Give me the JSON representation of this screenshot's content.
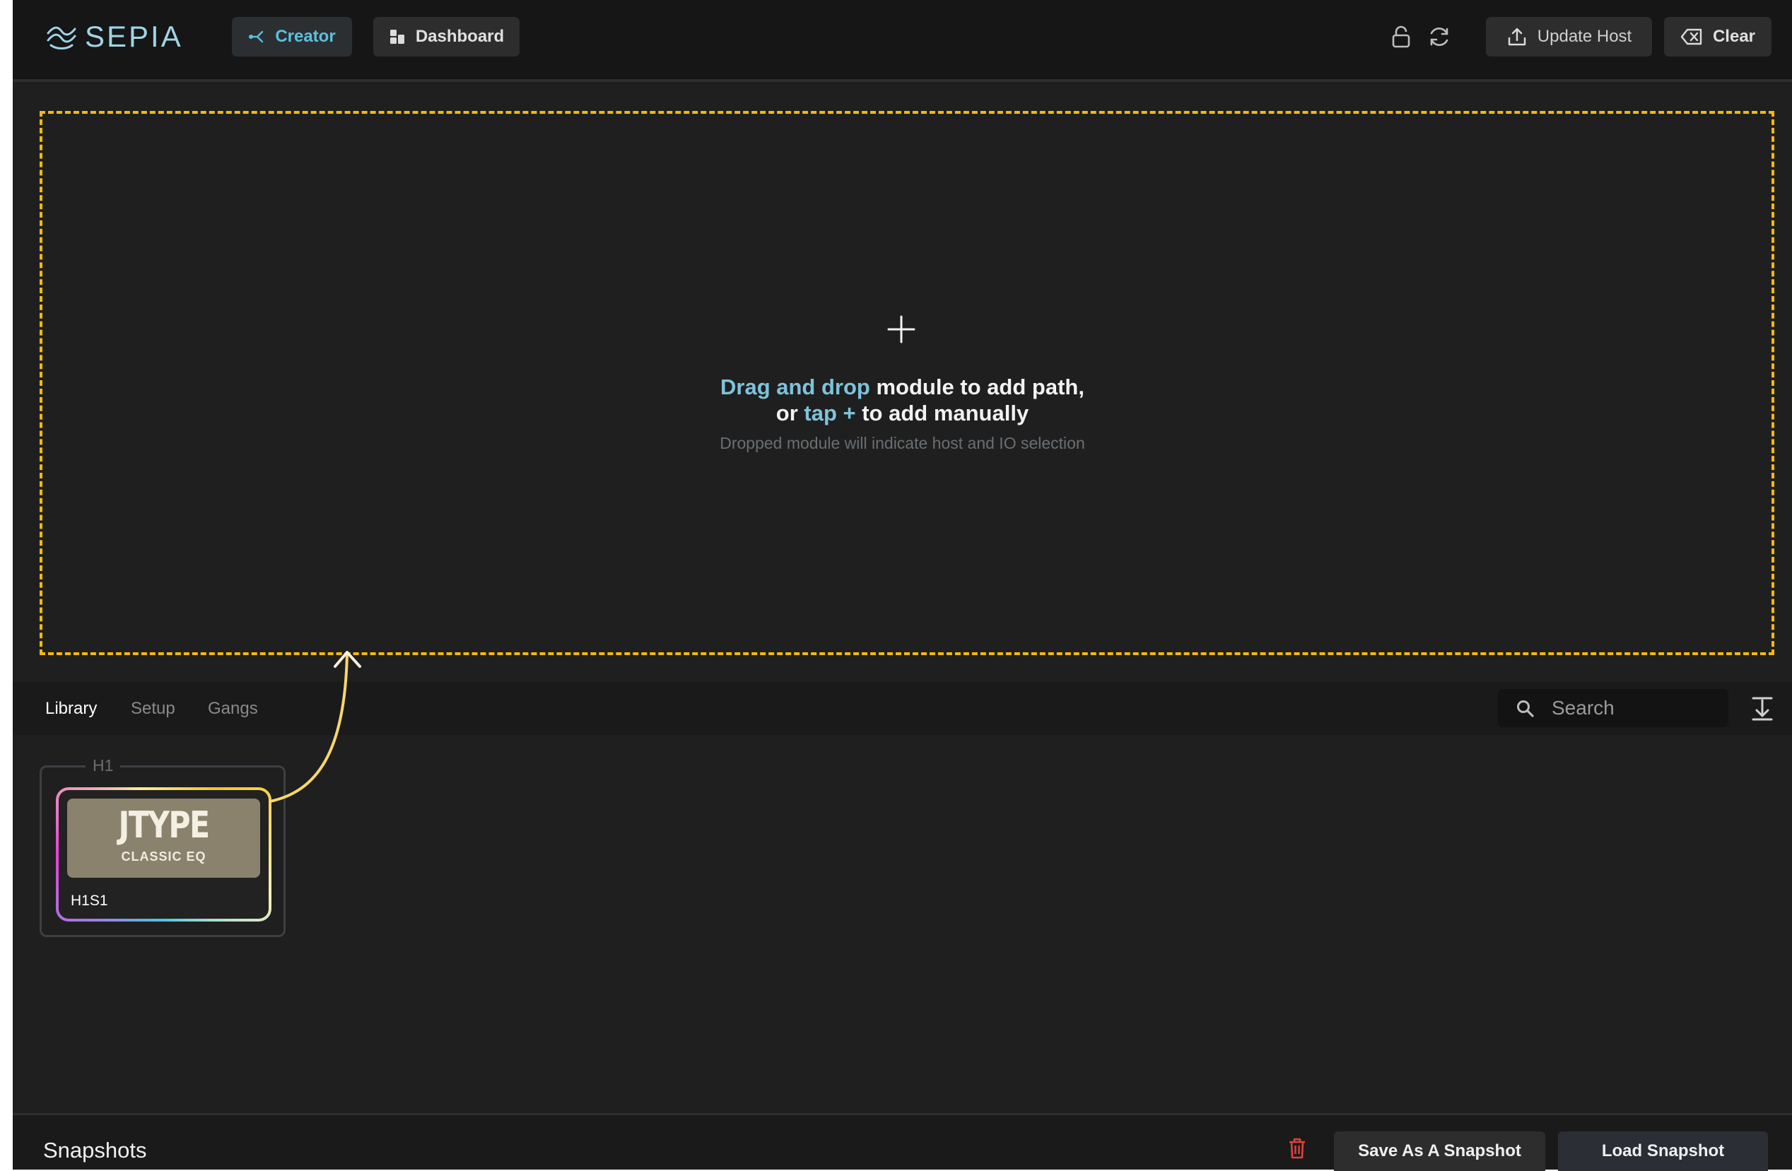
{
  "app": {
    "name": "SEPIA"
  },
  "header": {
    "tabs": [
      {
        "label": "Creator",
        "icon": "route-icon",
        "active": true
      },
      {
        "label": "Dashboard",
        "icon": "dashboard-icon",
        "active": false
      }
    ],
    "update_host_label": "Update Host",
    "clear_label": "Clear"
  },
  "dropzone": {
    "line1_highlight": "Drag and drop",
    "line1_rest": " module to add path,",
    "line2_prefix": "or ",
    "line2_highlight": "tap +",
    "line2_rest": " to add manually",
    "hint": "Dropped module will indicate host and IO selection"
  },
  "library": {
    "tabs": [
      {
        "label": "Library",
        "active": true
      },
      {
        "label": "Setup",
        "active": false
      },
      {
        "label": "Gangs",
        "active": false
      }
    ],
    "search_placeholder": "Search",
    "hosts": [
      {
        "label": "H1",
        "modules": [
          {
            "brand": "JTYPE",
            "subtitle": "CLASSIC EQ",
            "id": "H1S1"
          }
        ]
      }
    ]
  },
  "snapshots": {
    "title": "Snapshots",
    "save_label": "Save As A Snapshot",
    "load_label": "Load Snapshot"
  },
  "colors": {
    "accent": "#5cc0dd",
    "dropzone_border": "#f5b90e",
    "delete": "#e0413a",
    "background": "#1f1f1f"
  }
}
